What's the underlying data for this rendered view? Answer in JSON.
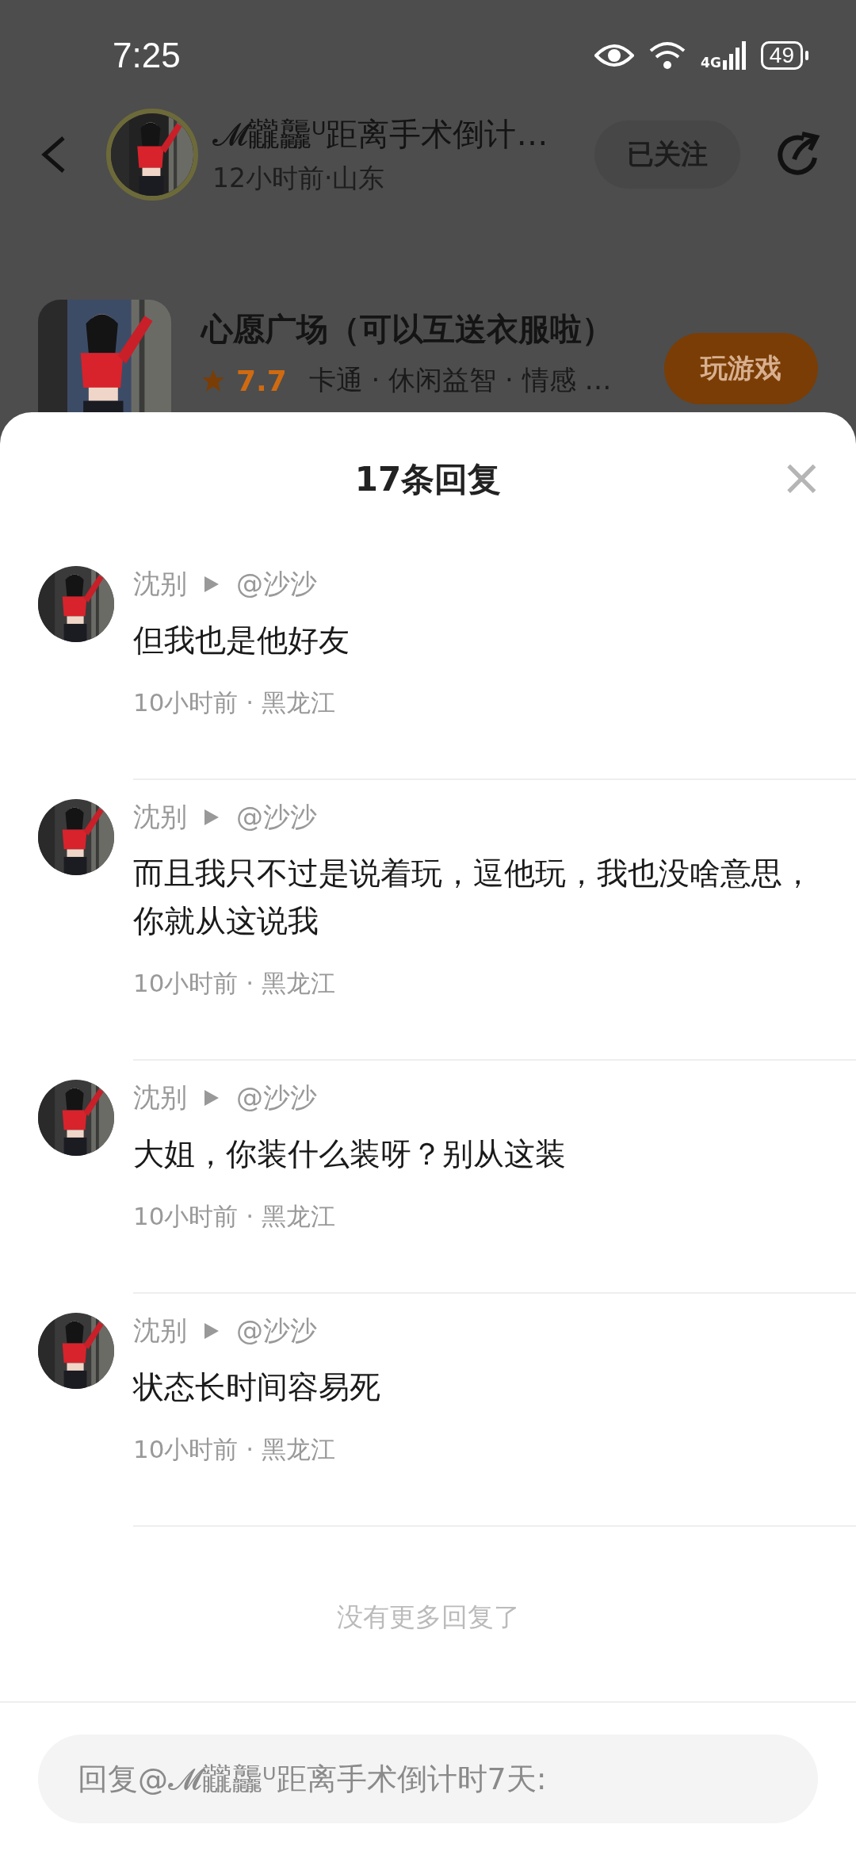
{
  "status_bar": {
    "time": "7:25",
    "network": "4G",
    "battery": "49"
  },
  "post_header": {
    "author": "𝓜龖龘ᵁ距离手术倒计…",
    "meta": "12小时前·山东",
    "follow_button": "已关注"
  },
  "game": {
    "title": "心愿广场（可以互送衣服啦）",
    "rating": "7.7",
    "tags": "卡通 · 休闲益智 · 情感 …",
    "play_button": "玩游戏"
  },
  "sheet": {
    "title": "17条回复",
    "close": "×"
  },
  "replies": [
    {
      "author": "沈别",
      "target": "@沙沙",
      "text": "但我也是他好友",
      "meta": "10小时前 · 黑龙江"
    },
    {
      "author": "沈别",
      "target": "@沙沙",
      "text": "而且我只不过是说着玩，逗他玩，我也没啥意思，你就从这说我",
      "meta": "10小时前 · 黑龙江"
    },
    {
      "author": "沈别",
      "target": "@沙沙",
      "text": "大姐，你装什么装呀？别从这装",
      "meta": "10小时前 · 黑龙江"
    },
    {
      "author": "沈别",
      "target": "@沙沙",
      "text": "状态长时间容易死",
      "meta": "10小时前 · 黑龙江"
    }
  ],
  "end_note": "没有更多回复了",
  "reply_input": {
    "placeholder": "回复@𝓜龖龘ᵁ距离手术倒计时7天:"
  }
}
